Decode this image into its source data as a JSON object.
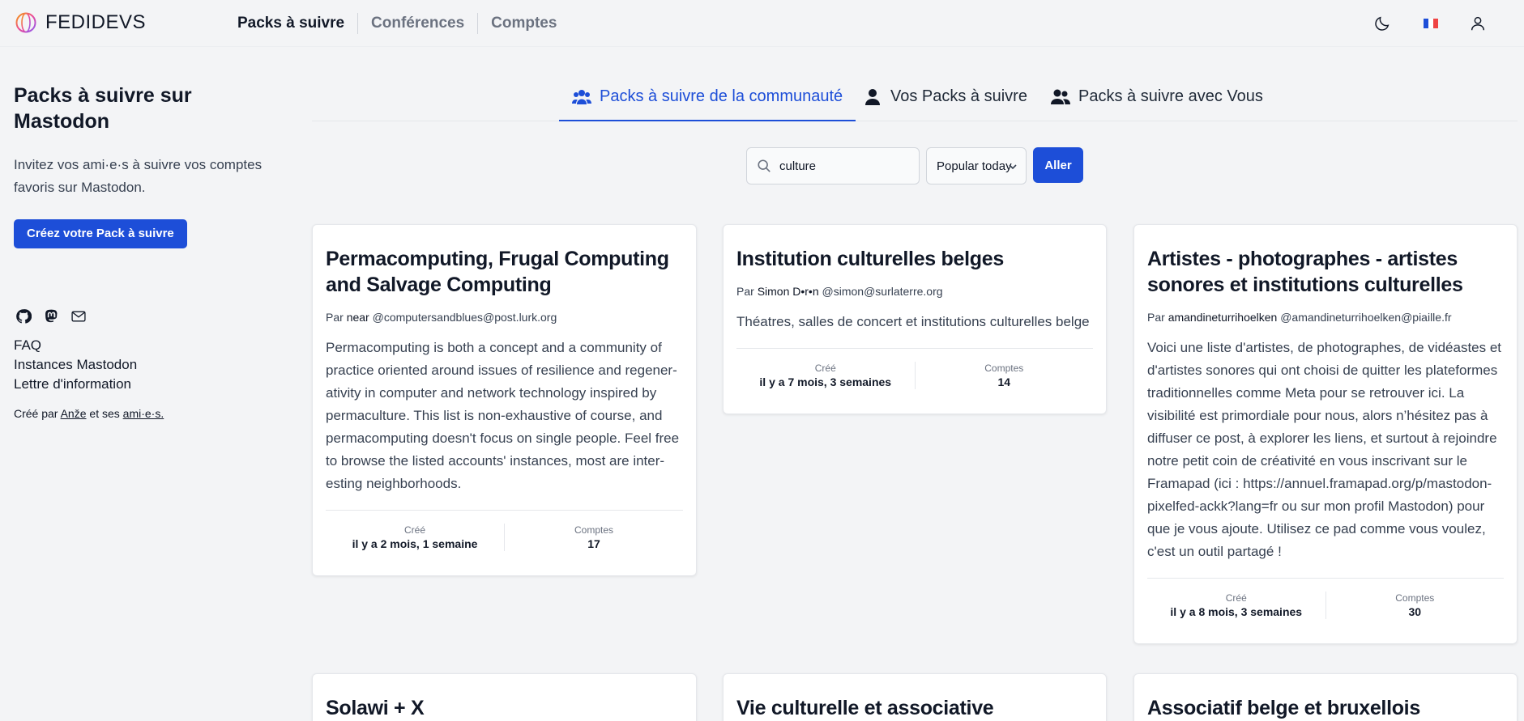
{
  "app": {
    "brand": "FEDIDEVS"
  },
  "nav": {
    "links": [
      "Packs à suivre",
      "Conférences",
      "Comptes"
    ],
    "language_flag": "fr-flag"
  },
  "sidebar": {
    "title": "Packs à suivre sur Mastodon",
    "description": "Invitez vos ami·e·s à suivre vos comptes favoris sur Mastodon.",
    "cta": "Créez votre Pack à suivre",
    "links": [
      "FAQ",
      "Instances Mastodon",
      "Lettre d'information"
    ],
    "credits": {
      "prefix": "Créé par ",
      "author": "Anže",
      "middle": " et ses ",
      "friends": "ami·e·s."
    }
  },
  "tabs": [
    {
      "label": "Packs à suivre de la communauté",
      "icon": "users-icon",
      "active": true
    },
    {
      "label": "Vos Packs à suivre",
      "icon": "user-icon",
      "active": false
    },
    {
      "label": "Packs à suivre avec Vous",
      "icon": "user-group-icon",
      "active": false
    }
  ],
  "search": {
    "value": "culture",
    "sort": "Popular today",
    "go": "Aller"
  },
  "card_labels": {
    "by": "Par",
    "created": "Créé",
    "accounts": "Comptes"
  },
  "cards": [
    {
      "title": "Permacomputing, Frugal Computing and Salvage Computing",
      "author": "near",
      "handle": "@computersandblues@post.lurk.org",
      "description": "Permacomputing is both a concept and a community of practice oriented around issues of resilience and regener­ativity in computer and network technology inspired by permaculture. This list is non-exhaustive of course, and permacomputing doesn't focus on single people. Feel free to browse the listed accounts' instances, most are inter­esting neighborhoods.",
      "created": "il y a 2 mois, 1 semaine",
      "accounts": "17"
    },
    {
      "title": "Institution culturelles belges",
      "author": "Simon D•r•n",
      "handle": "@simon@surlaterre.org",
      "description": "Théatres, salles de concert et institutions culturelles belge",
      "created": "il y a 7 mois, 3 semaines",
      "accounts": "14"
    },
    {
      "title": "Artistes - photographes - artistes sonores et institutions culturelles",
      "author": "amandineturrihoelken",
      "handle": "@amandineturrihoelken@piaille.fr",
      "description": "Voici une liste d'artistes, de photographes, de vidéastes et d'artistes sonores qui ont choisi de quitter les plate­formes traditionnelles comme Meta pour se retrouver ici. La visibilité est primordiale pour nous, alors n’hésitez pas à diffuser ce post, à explorer les liens, et surtout à rejoin­dre notre petit coin de créativité en vous inscrivant sur le Framapad (ici : https://annuel.framapad.org/p/mastodon-pixelfed-ackk?lang=fr ou sur mon profil Mastodon) pour que je vous ajoute. Utilisez ce pad comme vous voulez, c'est un outil partagé !",
      "created": "il y a 8 mois, 3 semaines",
      "accounts": "30"
    },
    {
      "title": "Solawi + X"
    },
    {
      "title": "Vie culturelle et associative"
    },
    {
      "title": "Associatif belge et bruxellois"
    }
  ],
  "colors": {
    "accent": "#1d4ed8",
    "background": "#f3f4f6"
  }
}
